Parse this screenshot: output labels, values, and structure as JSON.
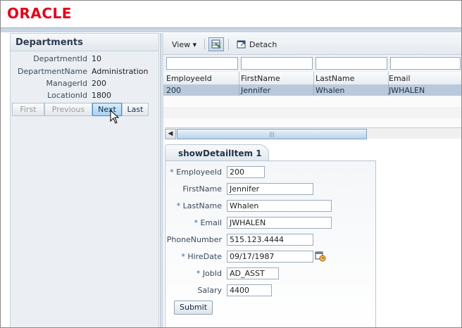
{
  "brand": {
    "logo_text": "ORACLE"
  },
  "departments": {
    "title": "Departments",
    "fields": [
      {
        "label": "DepartmentId",
        "value": "10"
      },
      {
        "label": "DepartmentName",
        "value": "Administration"
      },
      {
        "label": "ManagerId",
        "value": "200"
      },
      {
        "label": "LocationId",
        "value": "1800"
      }
    ],
    "nav": {
      "first": "First",
      "previous": "Previous",
      "next": "Next",
      "last": "Last"
    }
  },
  "toolbar": {
    "view_label": "View ▾",
    "detach_label": "Detach"
  },
  "table": {
    "columns": [
      "EmployeeId",
      "FirstName",
      "LastName",
      "Email"
    ],
    "rows": [
      [
        "200",
        "Jennifer",
        "Whalen",
        "JWHALEN"
      ]
    ],
    "scroll_grip": "|||"
  },
  "detail": {
    "tab_label": "showDetailItem 1",
    "fields": [
      {
        "label": "EmployeeId",
        "required": true,
        "value": "200"
      },
      {
        "label": "FirstName",
        "required": false,
        "value": "Jennifer"
      },
      {
        "label": "LastName",
        "required": true,
        "value": "Whalen"
      },
      {
        "label": "Email",
        "required": true,
        "value": "JWHALEN"
      },
      {
        "label": "PhoneNumber",
        "required": false,
        "value": "515.123.4444"
      },
      {
        "label": "HireDate",
        "required": true,
        "value": "09/17/1987"
      },
      {
        "label": "JobId",
        "required": true,
        "value": "AD_ASST"
      },
      {
        "label": "Salary",
        "required": false,
        "value": "4400"
      }
    ],
    "required_marker": "*",
    "submit_label": "Submit"
  },
  "colors": {
    "brand_red": "#e4001b",
    "selected_row": "#b9c9db",
    "accent_blue": "#2d6db5"
  }
}
